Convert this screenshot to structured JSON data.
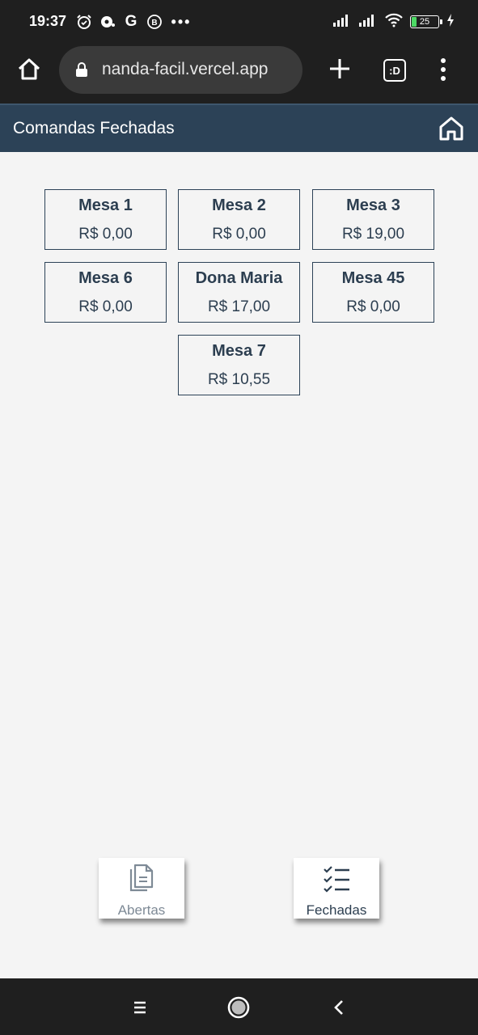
{
  "status_bar": {
    "time": "19:37",
    "g_label": "G",
    "dots": "•••",
    "battery": "25"
  },
  "browser": {
    "url": "nanda-facil.vercel.app",
    "tabs_label": ":D"
  },
  "header": {
    "title": "Comandas Fechadas"
  },
  "tables": [
    {
      "name": "Mesa 1",
      "value": "R$ 0,00"
    },
    {
      "name": "Mesa 2",
      "value": "R$ 0,00"
    },
    {
      "name": "Mesa 3",
      "value": "R$ 19,00"
    },
    {
      "name": "Mesa 6",
      "value": "R$ 0,00"
    },
    {
      "name": "Dona Maria",
      "value": "R$ 17,00"
    },
    {
      "name": "Mesa 45",
      "value": "R$ 0,00"
    },
    {
      "name": "Mesa 7",
      "value": "R$ 10,55"
    }
  ],
  "bottom_nav": {
    "abertas_label": "Abertas",
    "fechadas_label": "Fechadas"
  },
  "colors": {
    "header_bg": "#2c4257",
    "card_border": "#2c4257",
    "text_primary": "#2c3e50",
    "text_muted": "#7e8a96"
  }
}
